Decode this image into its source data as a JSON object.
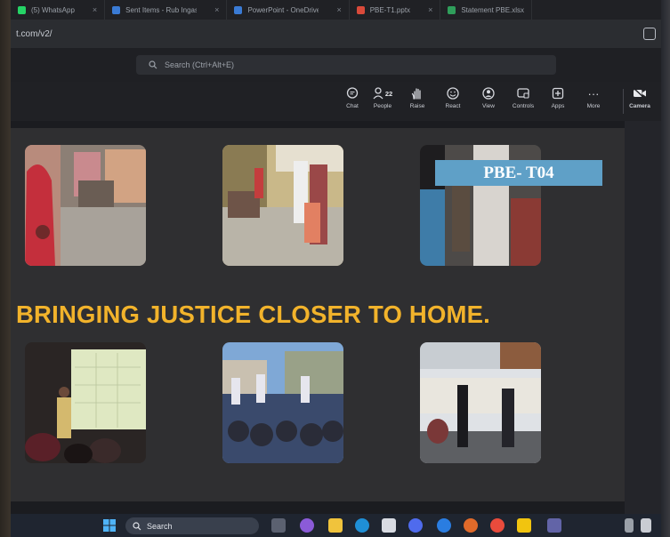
{
  "browser": {
    "tabs": [
      {
        "label": "(5) WhatsApp",
        "color": "#25d366"
      },
      {
        "label": "Sent Items - Rub Ingasett",
        "color": "#3a7bd5"
      },
      {
        "label": "PowerPoint - OneDrive",
        "color": "#3a7bd5"
      },
      {
        "label": "PBE-T1.pptx",
        "color": "#d94a3a"
      },
      {
        "label": "Statement PBE.xlsx",
        "color": "#2f9e5b"
      }
    ],
    "tab_close": "×",
    "url": "t.com/v2/"
  },
  "teams": {
    "search_placeholder": "Search (Ctrl+Alt+E)"
  },
  "toolbar": {
    "people_count": "22",
    "items": [
      {
        "label": "Chat",
        "icon": "chat-icon"
      },
      {
        "label": "People",
        "icon": "people-icon"
      },
      {
        "label": "Raise",
        "icon": "raise-hand-icon"
      },
      {
        "label": "React",
        "icon": "react-icon"
      },
      {
        "label": "View",
        "icon": "view-icon"
      },
      {
        "label": "Controls",
        "icon": "controls-icon"
      },
      {
        "label": "Apps",
        "icon": "apps-icon"
      },
      {
        "label": "More",
        "icon": "more-icon"
      }
    ],
    "camera_label": "Camera",
    "more_glyph": "···"
  },
  "slide": {
    "tag": "PBE- T04",
    "headline": "BRINGING JUSTICE CLOSER TO HOME.",
    "headline_color": "#f2b32b",
    "tag_color": "#5fa0c7"
  },
  "taskbar": {
    "search_label": "Search"
  }
}
